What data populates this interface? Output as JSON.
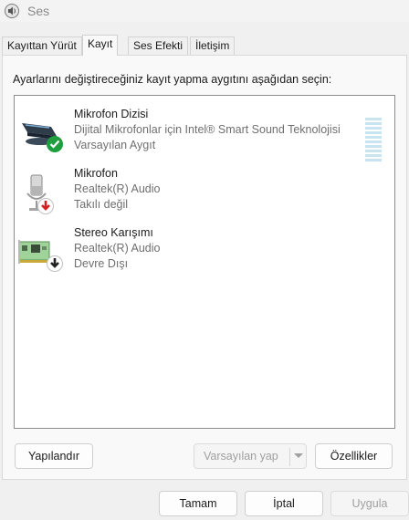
{
  "window": {
    "title": "Ses",
    "icon": "speaker-icon"
  },
  "tabs": [
    {
      "label": "Kayıttan Yürüt",
      "active": false
    },
    {
      "label": "Kayıt",
      "active": true
    },
    {
      "label": "Ses Efekti",
      "active": false
    },
    {
      "label": "İletişim",
      "active": false
    }
  ],
  "instruction": "Ayarlarını değiştireceğiniz kayıt yapma aygıtını aşağıdan seçin:",
  "devices": [
    {
      "name": "Mikrofon Dizisi",
      "detail": "Dijital Mikrofonlar için Intel® Smart Sound Teknolojisi",
      "status": "Varsayılan Aygıt",
      "icon": "microphone-array-icon",
      "badge": "default-check-icon",
      "badge_color": "#1e9e3e"
    },
    {
      "name": "Mikrofon",
      "detail": "Realtek(R) Audio",
      "status": "Takılı değil",
      "icon": "microphone-icon",
      "badge": "unplugged-arrow-icon",
      "badge_color": "#d42020"
    },
    {
      "name": "Stereo Karışımı",
      "detail": "Realtek(R) Audio",
      "status": "Devre Dışı",
      "icon": "sound-card-icon",
      "badge": "disabled-arrow-icon",
      "badge_color": "#222222"
    }
  ],
  "buttons": {
    "configure": "Yapılandır",
    "set_default": "Varsayılan yap",
    "properties": "Özellikler",
    "ok": "Tamam",
    "cancel": "İptal",
    "apply": "Uygula"
  },
  "colors": {
    "accent": "#0067c0",
    "level_meter": "#c7e4f0"
  }
}
